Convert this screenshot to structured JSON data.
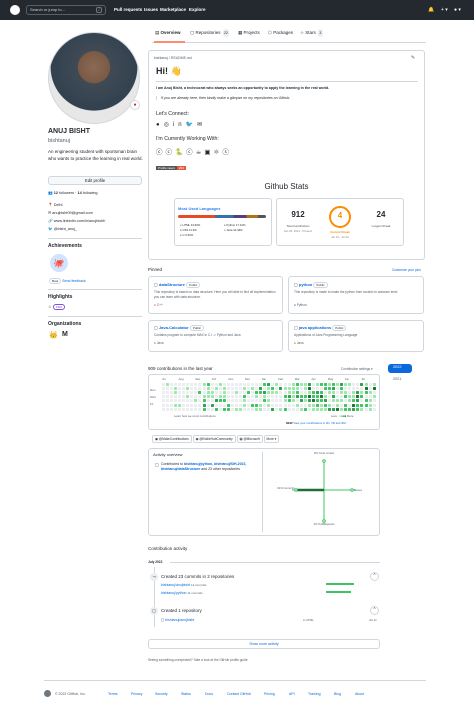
{
  "header": {
    "search_placeholder": "Search or jump to...",
    "search_key": "/",
    "nav": [
      "Pull requests",
      "Issues",
      "Marketplace",
      "Explore"
    ],
    "bell": "🔔",
    "plus": "+ ▾",
    "avatar": "● ▾"
  },
  "tabs": [
    {
      "label": "Overview",
      "count": ""
    },
    {
      "label": "Repositories",
      "count": "22"
    },
    {
      "label": "Projects",
      "count": ""
    },
    {
      "label": "Packages",
      "count": ""
    },
    {
      "label": "Stars",
      "count": "3"
    }
  ],
  "profile": {
    "name": "ANUJ BISHT",
    "login": "bishtanuj",
    "bio": "An engineering student with sportsman brain who wants to practice the learning in real world.",
    "edit_label": "Edit profile",
    "followers": "12",
    "followers_label": "followers",
    "following": "14",
    "following_label": "following",
    "location": "Delhi",
    "email": "anujbisht09@gmail.com",
    "linkedin": "www.linkedin.com/in/anujbisht/",
    "twitter": "@bisht_anuj_"
  },
  "achievements": {
    "title": "Achievements",
    "badge": "Beta",
    "feedback": "Send feedback",
    "badge_icon": "🐙"
  },
  "highlights": {
    "title": "Highlights",
    "pro": "PRO"
  },
  "organizations": {
    "title": "Organizations",
    "orgs": [
      "👑",
      "M"
    ]
  },
  "readme": {
    "path": "bishtanuj / README.md",
    "title": "Hi! 👋",
    "intro": "I am Anuj Bisht, a technocrat who always seeks an opportunity to apply the learning in the real world.",
    "quote": "If you are already here, then kindly make a glimpse on my repositories on Github.",
    "connect": "Let's Connect:",
    "working": "I'm Currently Working With:",
    "profile_views": "Profile views",
    "profile_views_count": "264",
    "stats_title": "Github Stats",
    "langs_title": "Most Used Languages",
    "langs": [
      {
        "name": "HTML",
        "pct": "34.69%",
        "color": "#e34c26"
      },
      {
        "name": "Python",
        "pct": "17.41%",
        "color": "#3572a5"
      },
      {
        "name": "CSS",
        "pct": "11.9%",
        "color": "#563d7c"
      },
      {
        "name": "Java",
        "pct": "10.44%",
        "color": "#b07219"
      },
      {
        "name": "C",
        "pct": "6.63%",
        "color": "#555555"
      }
    ],
    "total_contrib": "912",
    "total_contrib_label": "Total Contributions",
    "total_contrib_range": "Jan 26, 2021 - Present",
    "streak": "4",
    "streak_label": "Current Streak",
    "streak_range": "Jul 19 - Jul 22",
    "longest": "24",
    "longest_label": "Longest Streak"
  },
  "pinned": {
    "title": "Pinned",
    "customize": "Customize your pins",
    "items": [
      {
        "name": "dataStructure",
        "vis": "Public",
        "desc": "This repository is based on data structure. Here you will able to find all implementation you can learn with data structure.",
        "lang": "C++",
        "color": "#f34b7d"
      },
      {
        "name": "python",
        "vis": "Public",
        "desc": "This repository is made to make the python from scratch to advance level.",
        "lang": "Python",
        "color": "#3572a5"
      },
      {
        "name": "Java-Calculator",
        "vis": "Public",
        "desc": "Contains program to compute MAX in C.I -> Python and Java",
        "lang": "Java",
        "color": "#b07219"
      },
      {
        "name": "java applications",
        "vis": "Public",
        "desc": "Applications of Java Programming Language",
        "lang": "Java",
        "color": "#b07219"
      }
    ]
  },
  "contrib": {
    "title": "909 contributions in the last year",
    "settings": "Contribution settings ▾",
    "months": [
      "Jul",
      "Aug",
      "Sep",
      "Oct",
      "Nov",
      "Dec",
      "Jan",
      "Feb",
      "Mar",
      "Apr",
      "May",
      "Jun",
      "Jul"
    ],
    "days": [
      "Mon",
      "Wed",
      "Fri"
    ],
    "learn": "Learn how we count contributions",
    "less": "Less",
    "more": "More",
    "new_label": "NEW",
    "new_text": "View your contributions in 3D, VR and IRL!",
    "years": [
      "2022",
      "2021"
    ],
    "orgs": [
      "@MakeContributions",
      "@EddieHubCommunity",
      "@Microsoft",
      "More"
    ],
    "activity_title": "Activity overview",
    "contributed_prefix": "Contributed to",
    "contributed_links": "bishtanuj/python, bishtanuj/SIH-2022, bishtanuj/dataStructure",
    "contributed_suffix": "and 23 other repositories",
    "radar": {
      "code_review": "0% Code review",
      "commits": "91% Commits",
      "issues": "Issues",
      "pull_requests": "1% Pull requests"
    }
  },
  "activity": {
    "title": "Contribution activity",
    "month": "July 2022",
    "commits_title": "Created 23 commits in 2 repositories",
    "repos": [
      {
        "name": "bishtanuj/anujbisht",
        "count": "12 commits"
      },
      {
        "name": "bishtanuj/python",
        "count": "11 commits"
      }
    ],
    "created_title": "Created 1 repository",
    "created_repo": "bishtanuj/anujbisht",
    "created_lang": "HTML",
    "created_date": "Jul 11",
    "show_more": "Show more activity",
    "seeing": "Seeing something unexpected? Take a look at the GitHub profile guide."
  },
  "footer": {
    "copyright": "© 2022 GitHub, Inc.",
    "links": [
      "Terms",
      "Privacy",
      "Security",
      "Status",
      "Docs",
      "Contact GitHub",
      "Pricing",
      "API",
      "Training",
      "Blog",
      "About"
    ]
  },
  "colors": {
    "accent": "#0969da",
    "header": "#24292f",
    "streak": "#fb8c00",
    "green": [
      "#ebedf0",
      "#9be9a8",
      "#40c463",
      "#30a14e",
      "#216e39"
    ]
  }
}
